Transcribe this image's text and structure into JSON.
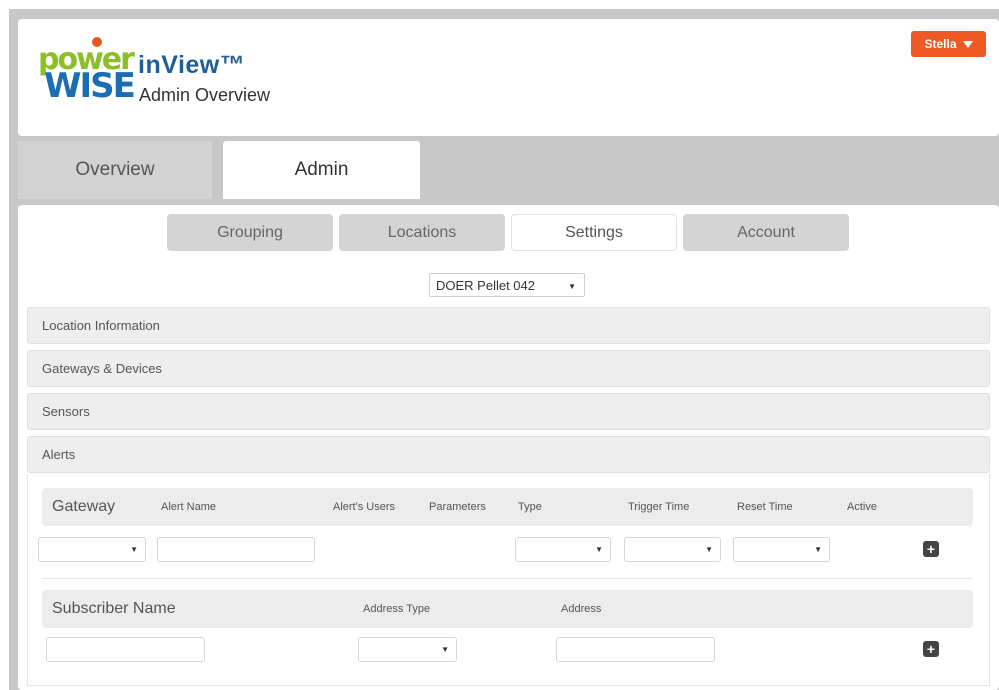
{
  "header": {
    "logo_top": "power",
    "logo_bottom": "WISE",
    "app_title": "inView™",
    "app_subtitle": "Admin Overview",
    "user_menu_label": "Stella"
  },
  "main_tabs": [
    {
      "label": "Overview",
      "active": false
    },
    {
      "label": "Admin",
      "active": true
    }
  ],
  "sub_tabs": [
    {
      "label": "Grouping",
      "active": false
    },
    {
      "label": "Locations",
      "active": false
    },
    {
      "label": "Settings",
      "active": true
    },
    {
      "label": "Account",
      "active": false
    }
  ],
  "location_select": {
    "value": "DOER Pellet 042"
  },
  "sections": [
    {
      "label": "Location Information"
    },
    {
      "label": "Gateways & Devices"
    },
    {
      "label": "Sensors"
    },
    {
      "label": "Alerts"
    }
  ],
  "alerts_table": {
    "columns": {
      "gateway": "Gateway",
      "alert_name": "Alert Name",
      "alerts_users": "Alert's Users",
      "parameters": "Parameters",
      "type": "Type",
      "trigger_time": "Trigger Time",
      "reset_time": "Reset Time",
      "active": "Active"
    },
    "add_label": "+"
  },
  "subscriber_table": {
    "columns": {
      "subscriber_name": "Subscriber Name",
      "address_type": "Address Type",
      "address": "Address"
    },
    "add_label": "+"
  },
  "colors": {
    "accent": "#ee5a24",
    "brand_green": "#8cbf26",
    "brand_blue": "#1a6fb3"
  }
}
